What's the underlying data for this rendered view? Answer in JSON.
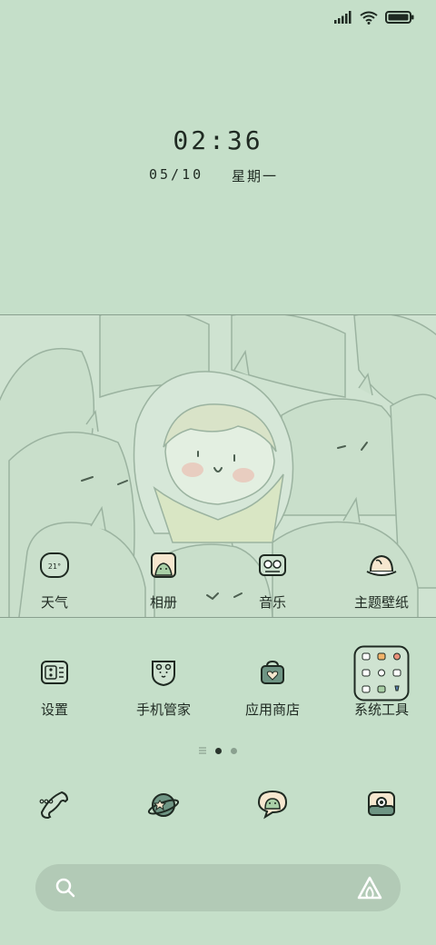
{
  "status_bar": {
    "signal_icon": "signal-icon",
    "wifi_icon": "wifi-icon",
    "battery_icon": "battery-icon"
  },
  "lockclock": {
    "time": "02:36",
    "date": "05/10",
    "weekday": "星期一"
  },
  "row1": [
    {
      "label": "天气",
      "icon": "weather-icon",
      "badge": "21°"
    },
    {
      "label": "相册",
      "icon": "gallery-icon"
    },
    {
      "label": "音乐",
      "icon": "music-icon"
    },
    {
      "label": "主题壁纸",
      "icon": "theme-icon"
    }
  ],
  "row2": [
    {
      "label": "设置",
      "icon": "settings-icon"
    },
    {
      "label": "手机管家",
      "icon": "security-icon"
    },
    {
      "label": "应用商店",
      "icon": "app-store-icon"
    },
    {
      "label": "系统工具",
      "icon": "folder-icon"
    }
  ],
  "dock": [
    {
      "icon": "phone-icon"
    },
    {
      "icon": "browser-icon"
    },
    {
      "icon": "messages-icon"
    },
    {
      "icon": "camera-icon"
    }
  ],
  "search_bar": {
    "search_icon": "search-icon",
    "assistant_icon": "assistant-icon"
  },
  "colors": {
    "background": "#c5dfc9",
    "search_bar": "#b2cab6",
    "ink": "#1f2a22"
  }
}
